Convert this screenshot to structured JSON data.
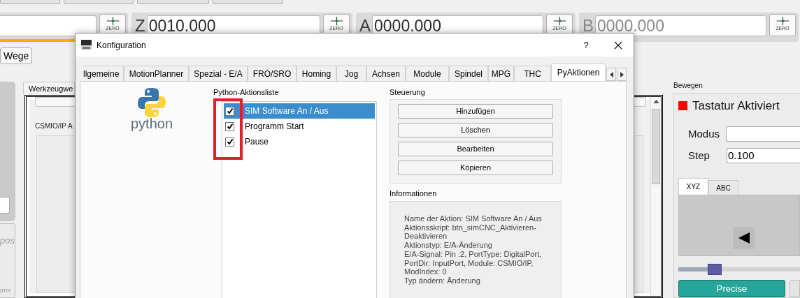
{
  "background": {
    "axes": [
      {
        "zero_label": "ZERO"
      },
      {
        "label": "Z",
        "value": "0010.000",
        "zero_label": "ZERO",
        "disabled": false
      },
      {
        "label": "A",
        "value": "0000.000",
        "zero_label": "ZERO",
        "disabled": false
      },
      {
        "label": "B",
        "value": "0000.000",
        "zero_label": "ZERO",
        "disabled": true
      }
    ],
    "paths_button": "Wege",
    "side_texts": [
      "pos",
      "mm"
    ],
    "tab": "Werkzeugwe",
    "module_label": "CSMIO/IP A",
    "jog": {
      "title": "Bewegen",
      "keyboard": {
        "label": "Tastatur Aktiviert",
        "active": false
      },
      "mode": {
        "label": "Modus"
      },
      "step": {
        "label": "Step",
        "value": "0.100"
      },
      "tabs": [
        {
          "label": "XYZ",
          "selected": true
        },
        {
          "label": "ABC",
          "selected": false
        }
      ],
      "speed": {
        "level": 0.25
      },
      "buttons": [
        "Precise"
      ]
    }
  },
  "dialog": {
    "title": "Konfiguration",
    "help": "?",
    "tabs": [
      {
        "label": "llgemeine",
        "selected": false
      },
      {
        "label": "MotionPlanner",
        "selected": false
      },
      {
        "label": "Spezial - E/A",
        "selected": false
      },
      {
        "label": "FRO/SRO",
        "selected": false
      },
      {
        "label": "Homing",
        "selected": false
      },
      {
        "label": "Jog",
        "selected": false
      },
      {
        "label": "Achsen",
        "selected": false
      },
      {
        "label": "Module",
        "selected": false
      },
      {
        "label": "Spindel",
        "selected": false
      },
      {
        "label": "MPG",
        "selected": false
      },
      {
        "label": "THC",
        "selected": false
      },
      {
        "label": "PyAktionen",
        "selected": true
      }
    ],
    "logo_text": "python",
    "list_title": "Python-Aktionsliste",
    "actions": [
      {
        "label": "SIM Software An / Aus",
        "checked": true,
        "selected": true
      },
      {
        "label": "Programm Start",
        "checked": true,
        "selected": false
      },
      {
        "label": "Pause",
        "checked": true,
        "selected": false
      }
    ],
    "controls_title": "Steuerung",
    "buttons": [
      "Hinzufügen",
      "Löschen",
      "Bearbeiten",
      "Kopieren"
    ],
    "info_title": "Informationen",
    "info_lines": [
      "Name der Aktion: SIM Software An / Aus",
      "Aktionsskript: btn_simCNC_Aktivieren-",
      "Deaktivieren",
      "Aktionstyp: E/A-Änderung",
      "E/A-Signal: Pin :2, PortType: DigitalPort,",
      "PortDir: InputPort, Module: CSMIO/IP,",
      "ModIndex: 0",
      "Typ ändern: Änderung"
    ]
  }
}
